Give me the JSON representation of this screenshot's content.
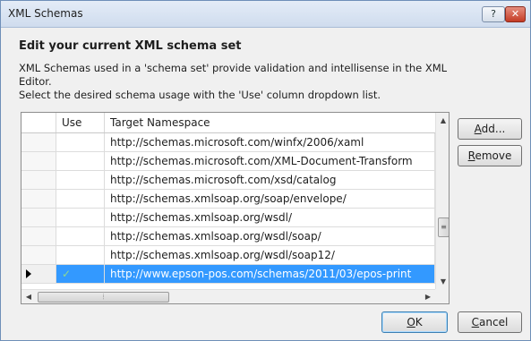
{
  "window": {
    "title": "XML Schemas",
    "help_label": "?",
    "close_label": "✕"
  },
  "content": {
    "heading": "Edit your current XML schema set",
    "desc_line1": "XML Schemas used in a 'schema set' provide validation and intellisense in the XML",
    "desc_line2": "Editor.",
    "desc_line3": "Select the desired schema usage with the 'Use' column dropdown list."
  },
  "grid": {
    "columns": [
      "",
      "Use",
      "Target Namespace"
    ],
    "rows": [
      {
        "use": "",
        "namespace": "http://schemas.microsoft.com/winfx/2006/xaml",
        "selected": false
      },
      {
        "use": "",
        "namespace": "http://schemas.microsoft.com/XML-Document-Transform",
        "selected": false
      },
      {
        "use": "",
        "namespace": "http://schemas.microsoft.com/xsd/catalog",
        "selected": false
      },
      {
        "use": "",
        "namespace": "http://schemas.xmlsoap.org/soap/envelope/",
        "selected": false
      },
      {
        "use": "",
        "namespace": "http://schemas.xmlsoap.org/wsdl/",
        "selected": false
      },
      {
        "use": "",
        "namespace": "http://schemas.xmlsoap.org/wsdl/soap/",
        "selected": false
      },
      {
        "use": "",
        "namespace": "http://schemas.xmlsoap.org/wsdl/soap12/",
        "selected": false
      },
      {
        "use": "✓",
        "namespace": "http://www.epson-pos.com/schemas/2011/03/epos-print",
        "selected": true
      }
    ]
  },
  "buttons": {
    "add_hot": "A",
    "add_rest": "dd...",
    "remove_hot": "R",
    "remove_rest": "emove",
    "ok_hot": "O",
    "ok_rest": "K",
    "cancel_hot": "C",
    "cancel_rest": "ancel"
  },
  "colors": {
    "selection": "#3399ff",
    "check": "#8fd98f",
    "close": "#c43b25"
  }
}
